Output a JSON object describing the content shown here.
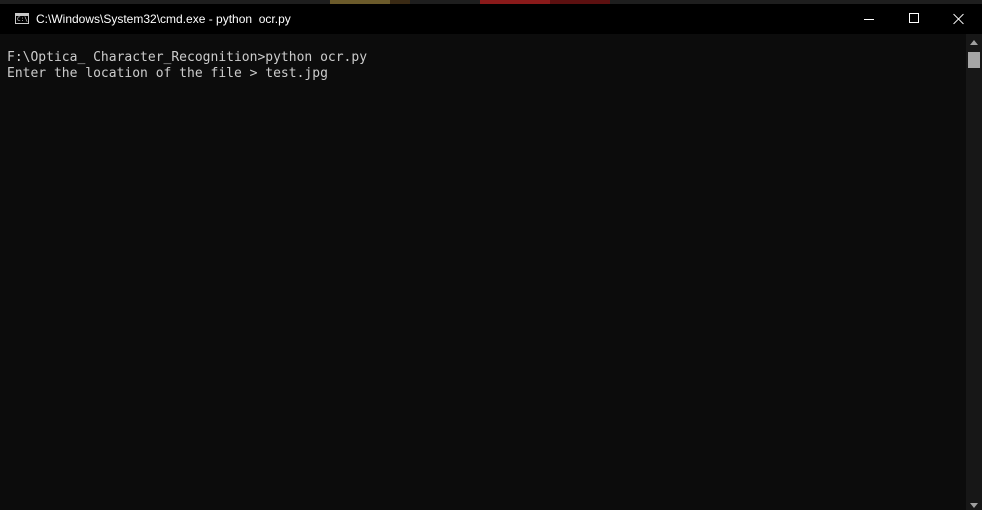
{
  "window": {
    "title": "C:\\Windows\\System32\\cmd.exe - python  ocr.py",
    "icon": "cmd-console-icon",
    "icon_label": "C:\\"
  },
  "controls": {
    "minimize_icon": "minimize-icon",
    "maximize_icon": "maximize-icon",
    "close_icon": "close-icon"
  },
  "console": {
    "lines": [
      "F:\\Optica_ Character_Recognition>python ocr.py",
      "Enter the location of the file > test.jpg"
    ],
    "text_color": "#cccccc",
    "background_color": "#0c0c0c"
  },
  "scrollbar": {
    "up_icon": "scroll-up-arrow-icon",
    "down_icon": "scroll-down-arrow-icon"
  },
  "colors": {
    "titlebar": "#000000",
    "title_text": "#ffffff",
    "scrollbar_track": "#171717",
    "scrollbar_thumb": "#a6a6a6"
  }
}
